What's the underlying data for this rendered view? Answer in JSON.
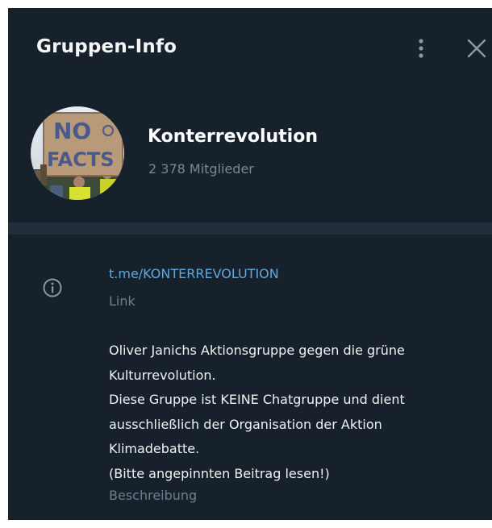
{
  "header": {
    "title": "Gruppen-Info",
    "menu_icon": "more-vertical-icon",
    "close_icon": "close-icon"
  },
  "group": {
    "name": "Konterrevolution",
    "members": "2 378 Mitglieder",
    "avatar_sign_text": [
      "NO",
      "FACTS"
    ]
  },
  "info": {
    "icon": "info-icon",
    "link": "t.me/KONTERREVOLUTION",
    "link_caption": "Link",
    "description_lines": [
      "Oliver Janichs Aktionsgruppe gegen die grüne",
      "Kulturrevolution.",
      "Diese Gruppe ist KEINE Chatgruppe und dient",
      "ausschließlich der Organisation der Aktion",
      "Klimadebatte.",
      "(Bitte angepinnten Beitrag lesen!)"
    ],
    "description_caption": "Beschreibung"
  },
  "colors": {
    "panel_bg": "#17212b",
    "divider": "#232e3c",
    "link": "#5ea8e0",
    "secondary_text": "#6d7f8f"
  }
}
